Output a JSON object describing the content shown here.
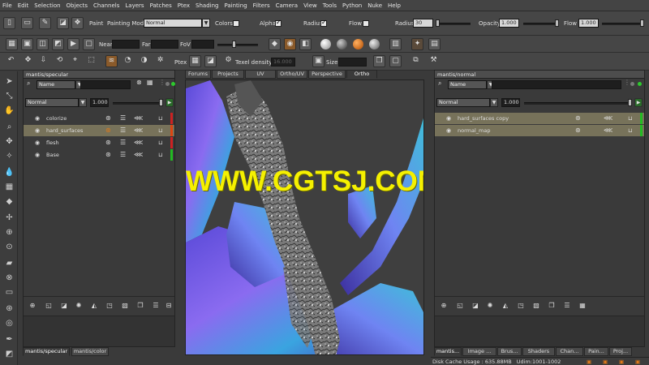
{
  "menu": [
    "File",
    "Edit",
    "Selection",
    "Objects",
    "Channels",
    "Layers",
    "Patches",
    "Ptex",
    "Shading",
    "Painting",
    "Filters",
    "Camera",
    "View",
    "Tools",
    "Python",
    "Nuke",
    "Help"
  ],
  "paint_toolbar": {
    "paint_label": "Paint",
    "painting_mode_label": "Painting Mode",
    "painting_mode_value": "Normal",
    "colors_label": "Colors",
    "alpha_label": "Alpha",
    "radius_chk_label": "Radius",
    "flow_chk_label": "Flow",
    "radius_label": "Radius",
    "radius_value": "30",
    "opacity_label": "Opacity",
    "opacity_value": "1.000",
    "flow_label": "Flow",
    "flow_value": "1.000"
  },
  "view_toolbar": {
    "near_label": "Near",
    "far_label": "Far",
    "fov_label": "FoV"
  },
  "ptex_toolbar": {
    "ptex_label": "Ptex",
    "texel_density_label": "Texel density",
    "texel_density_value": "16.000",
    "size_label": "Size"
  },
  "left_panel": {
    "title": "mantis/specular",
    "filter_label": "Name",
    "blend_mode": "Normal",
    "opacity": "1.000",
    "layers": [
      {
        "name": "colorize",
        "color": "#cc2222"
      },
      {
        "name": "hard_surfaces",
        "color": "#dd4411",
        "selected": true
      },
      {
        "name": "flesh",
        "color": "#cc2222"
      },
      {
        "name": "Base",
        "color": "#22bb22"
      }
    ],
    "bottom_tabs": [
      "mantis/specular",
      "mantis/color"
    ]
  },
  "viewport": {
    "tabs": [
      "Forums",
      "Projects",
      "UV",
      "Ortho/UV",
      "Perspective",
      "Ortho"
    ],
    "active_tab": "Ortho",
    "watermark": "WWW.CGTSJ.COM"
  },
  "right_panel": {
    "title": "mantis/normal",
    "filter_label": "Name",
    "blend_mode": "Normal",
    "opacity": "1.000",
    "layers": [
      {
        "name": "hard_surfaces copy",
        "color": "#22bb22",
        "selected": true
      },
      {
        "name": "normal_map",
        "color": "#22bb22",
        "selected": true
      }
    ],
    "bottom_tabs": [
      "mantis...",
      "Image ...",
      "Brus...",
      "Shaders",
      "Chan...",
      "Pain...",
      "Proj..."
    ]
  },
  "status": {
    "disk_cache_label": "Disk Cache Usage :",
    "disk_cache_value": "635.88MB",
    "udim_label": "Udim:",
    "udim_value": "1001-1002"
  },
  "colors": {
    "accent_orange": "#e07a1a",
    "selected_row": "#77725a",
    "watermark": "#f5f000"
  }
}
